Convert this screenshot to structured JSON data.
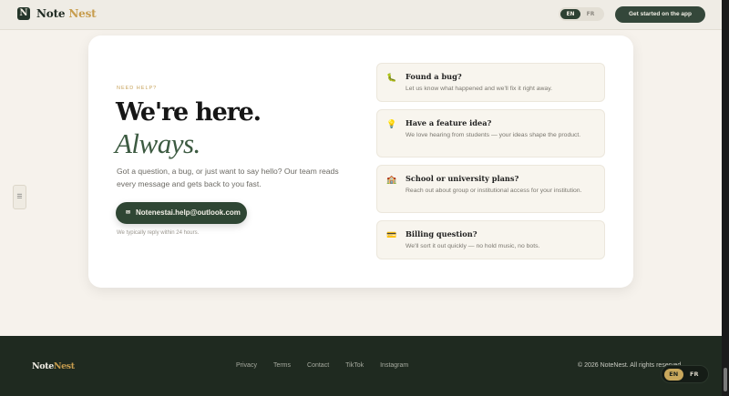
{
  "header": {
    "logo_mark": "N",
    "logo_word1": "Note",
    "logo_word2": "Nest",
    "lang": {
      "en": "EN",
      "fr": "FR",
      "active": "EN"
    },
    "cta": "Get started on the app"
  },
  "side_tab": {
    "icon": "menu-lines-icon",
    "glyph": "☰"
  },
  "contact": {
    "eyebrow": "NEED HELP?",
    "headline": "We're here.",
    "headline_italic": "Always.",
    "intro": "Got a question, a bug, or just want to say hello? Our team reads every message and gets back to you fast.",
    "email_icon": "✉",
    "email": "Notenestai.help@outlook.com",
    "reply_note": "We typically reply within 24 hours."
  },
  "topics": [
    {
      "icon": "🐛",
      "icon_name": "bug-icon",
      "title": "Found a bug?",
      "desc": "Let us know what happened and we'll fix it right away."
    },
    {
      "icon": "💡",
      "icon_name": "lightbulb-icon",
      "title": "Have a feature idea?",
      "desc": "We love hearing from students — your ideas shape the product."
    },
    {
      "icon": "🏫",
      "icon_name": "school-icon",
      "title": "School or university plans?",
      "desc": "Reach out about group or institutional access for your institution."
    },
    {
      "icon": "💳",
      "icon_name": "credit-card-icon",
      "title": "Billing question?",
      "desc": "We'll sort it out quickly — no hold music, no bots."
    }
  ],
  "footer": {
    "logo_word1": "Note",
    "logo_word2": "Nest",
    "links": [
      "Privacy",
      "Terms",
      "Contact",
      "TikTok",
      "Instagram"
    ],
    "copyright": "© 2026 NoteNest. All rights reserved.",
    "lang": {
      "en": "EN",
      "fr": "FR",
      "active": "EN"
    }
  },
  "colors": {
    "brand_dark": "#2f4634",
    "brand_gold": "#c79d4e",
    "page_bg": "#f6f2ec",
    "footer_bg": "#1f2a20"
  }
}
